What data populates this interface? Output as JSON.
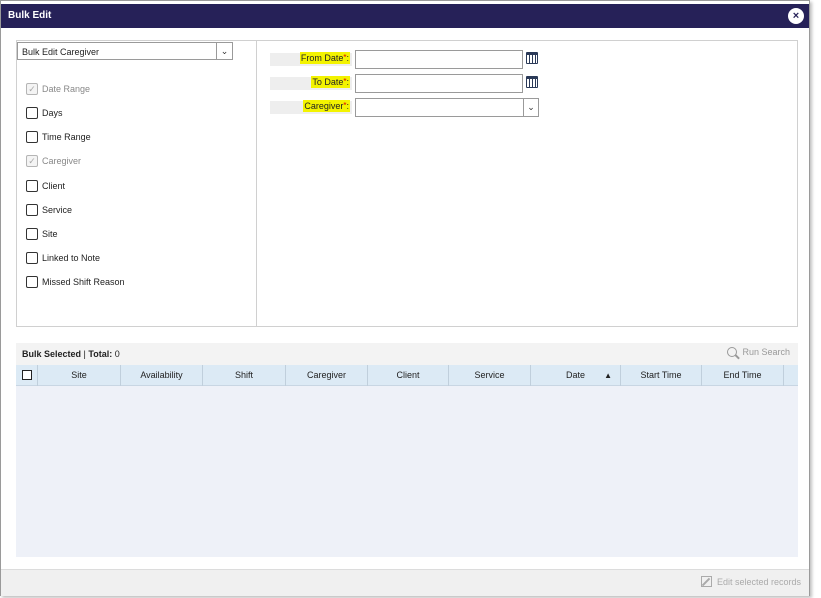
{
  "dialog": {
    "title": "Bulk Edit",
    "close_glyph": "×"
  },
  "left_pane": {
    "edit_type_select": "Bulk Edit Caregiver",
    "options": [
      {
        "label": "Date Range",
        "checked": true,
        "disabled": true
      },
      {
        "label": "Days",
        "checked": false,
        "disabled": false
      },
      {
        "label": "Time Range",
        "checked": false,
        "disabled": false
      },
      {
        "label": "Caregiver",
        "checked": true,
        "disabled": true
      },
      {
        "label": "Client",
        "checked": false,
        "disabled": false
      },
      {
        "label": "Service",
        "checked": false,
        "disabled": false
      },
      {
        "label": "Site",
        "checked": false,
        "disabled": false
      },
      {
        "label": "Linked to Note",
        "checked": false,
        "disabled": false
      },
      {
        "label": "Missed Shift Reason",
        "checked": false,
        "disabled": false
      }
    ]
  },
  "form": {
    "from_date_label": "From Date",
    "to_date_label": "To Date",
    "caregiver_label": "Caregiver",
    "required_mark": "*",
    "colon": ":",
    "from_date_value": "",
    "to_date_value": "",
    "caregiver_value": ""
  },
  "grid": {
    "bulk_selected_label": "Bulk Selected",
    "total_label": "Total:",
    "total_value": "0",
    "separator": "|",
    "run_search_label": "Run Search",
    "columns": [
      "Site",
      "Availability",
      "Shift",
      "Caregiver",
      "Client",
      "Service",
      "Date",
      "Start Time",
      "End Time"
    ],
    "sort_glyph": "▲",
    "rows": []
  },
  "footer": {
    "edit_selected_label": "Edit selected records"
  },
  "icons": {
    "search": "search-icon",
    "calendar": "calendar-icon",
    "edit": "edit-icon",
    "chevron": "chevron-down-icon",
    "close": "close-icon"
  },
  "colors": {
    "titlebar": "#262158",
    "highlight": "#f3f300",
    "grid_header": "#dceaf5",
    "grid_body": "#eef1f8",
    "required": "#dd0000"
  }
}
